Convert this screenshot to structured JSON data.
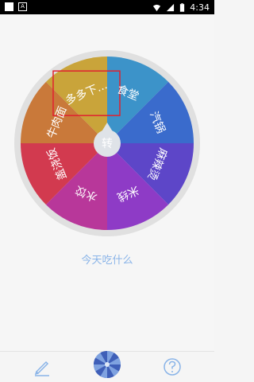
{
  "status_bar": {
    "time": "4:34",
    "left_icons": [
      "square-icon",
      "a-badge-icon"
    ],
    "right_icons": [
      "wifi-icon",
      "signal-icon",
      "battery-icon"
    ],
    "badge_text": "A"
  },
  "wheel": {
    "center_label": "转",
    "highlighted_segment": 0,
    "segments": [
      {
        "label": "多多下...",
        "color": "#c9a43a"
      },
      {
        "label": "食堂",
        "color": "#3c93c9"
      },
      {
        "label": "汽锅",
        "color": "#3a6bcc"
      },
      {
        "label": "麻辣烫",
        "color": "#5d46c8"
      },
      {
        "label": "米线",
        "color": "#8e3bc6"
      },
      {
        "label": "水饺",
        "color": "#b8379a"
      },
      {
        "label": "盖浇饭",
        "color": "#d23a4f"
      },
      {
        "label": "牛肉面",
        "color": "#c9793a"
      }
    ],
    "colors": {
      "rim": "#e0e0e0",
      "hub": "#dfe3e8",
      "text": "#ffffff",
      "highlight": "#e0212f"
    }
  },
  "prompt_text": "今天吃什么",
  "tabbar": {
    "items": [
      {
        "name": "edit",
        "icon": "pencil-icon"
      },
      {
        "name": "spin",
        "icon": "wheel-icon"
      },
      {
        "name": "help",
        "icon": "question-icon"
      }
    ],
    "colors": {
      "icon": "#8ab4e8"
    }
  }
}
